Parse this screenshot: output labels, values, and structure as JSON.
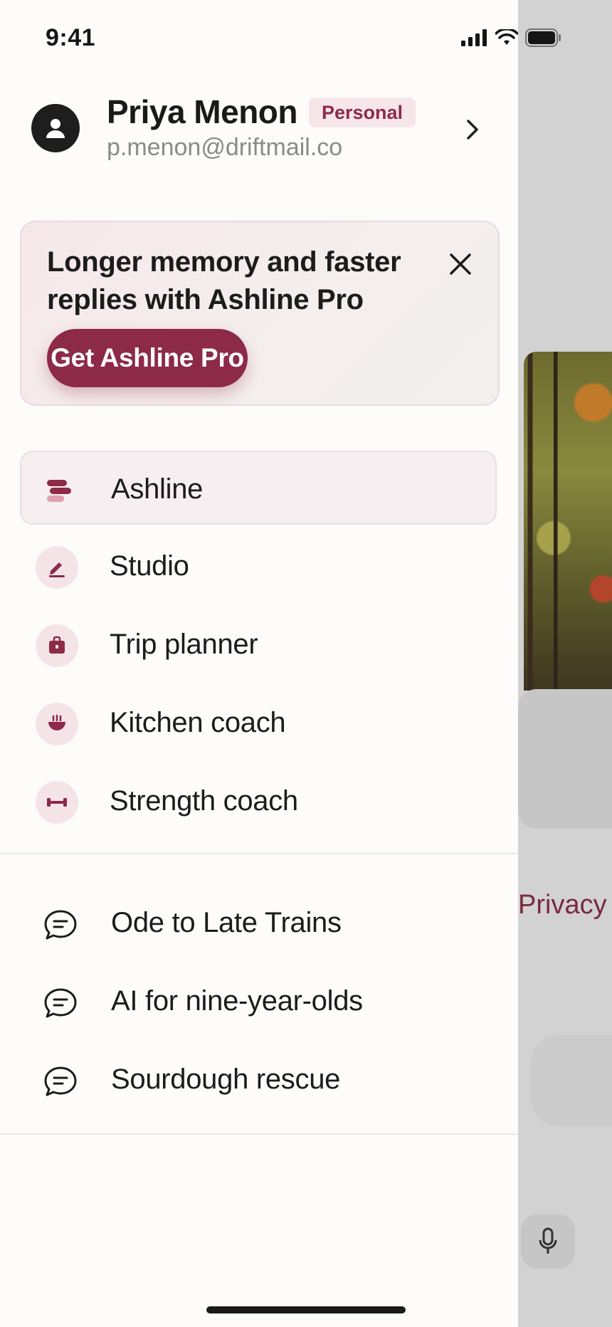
{
  "status_bar": {
    "time": "9:41"
  },
  "profile": {
    "name": "Priya Menon",
    "badge": "Personal",
    "email": "p.menon@driftmail.co"
  },
  "promo": {
    "text": "Longer memory and faster replies with Ashline Pro",
    "button_label": "Get Ashline Pro"
  },
  "nav": {
    "items": [
      {
        "label": "Ashline",
        "icon": "ashline-logo-icon",
        "active": true
      },
      {
        "label": "Studio",
        "icon": "pencil-icon"
      },
      {
        "label": "Trip planner",
        "icon": "suitcase-icon"
      },
      {
        "label": "Kitchen coach",
        "icon": "bowl-icon"
      },
      {
        "label": "Strength coach",
        "icon": "dumbbell-icon"
      }
    ]
  },
  "chats": {
    "items": [
      {
        "label": "Ode to Late Trains",
        "icon": "chat-bubble-icon"
      },
      {
        "label": "AI for nine-year-olds",
        "icon": "chat-bubble-icon"
      },
      {
        "label": "Sourdough rescue",
        "icon": "chat-bubble-icon"
      }
    ]
  },
  "background": {
    "privacy_link": "Privacy"
  },
  "colors": {
    "accent": "#8c2a48",
    "badge_bg": "#f6e6ea",
    "drawer_bg": "#fdfcfb"
  }
}
